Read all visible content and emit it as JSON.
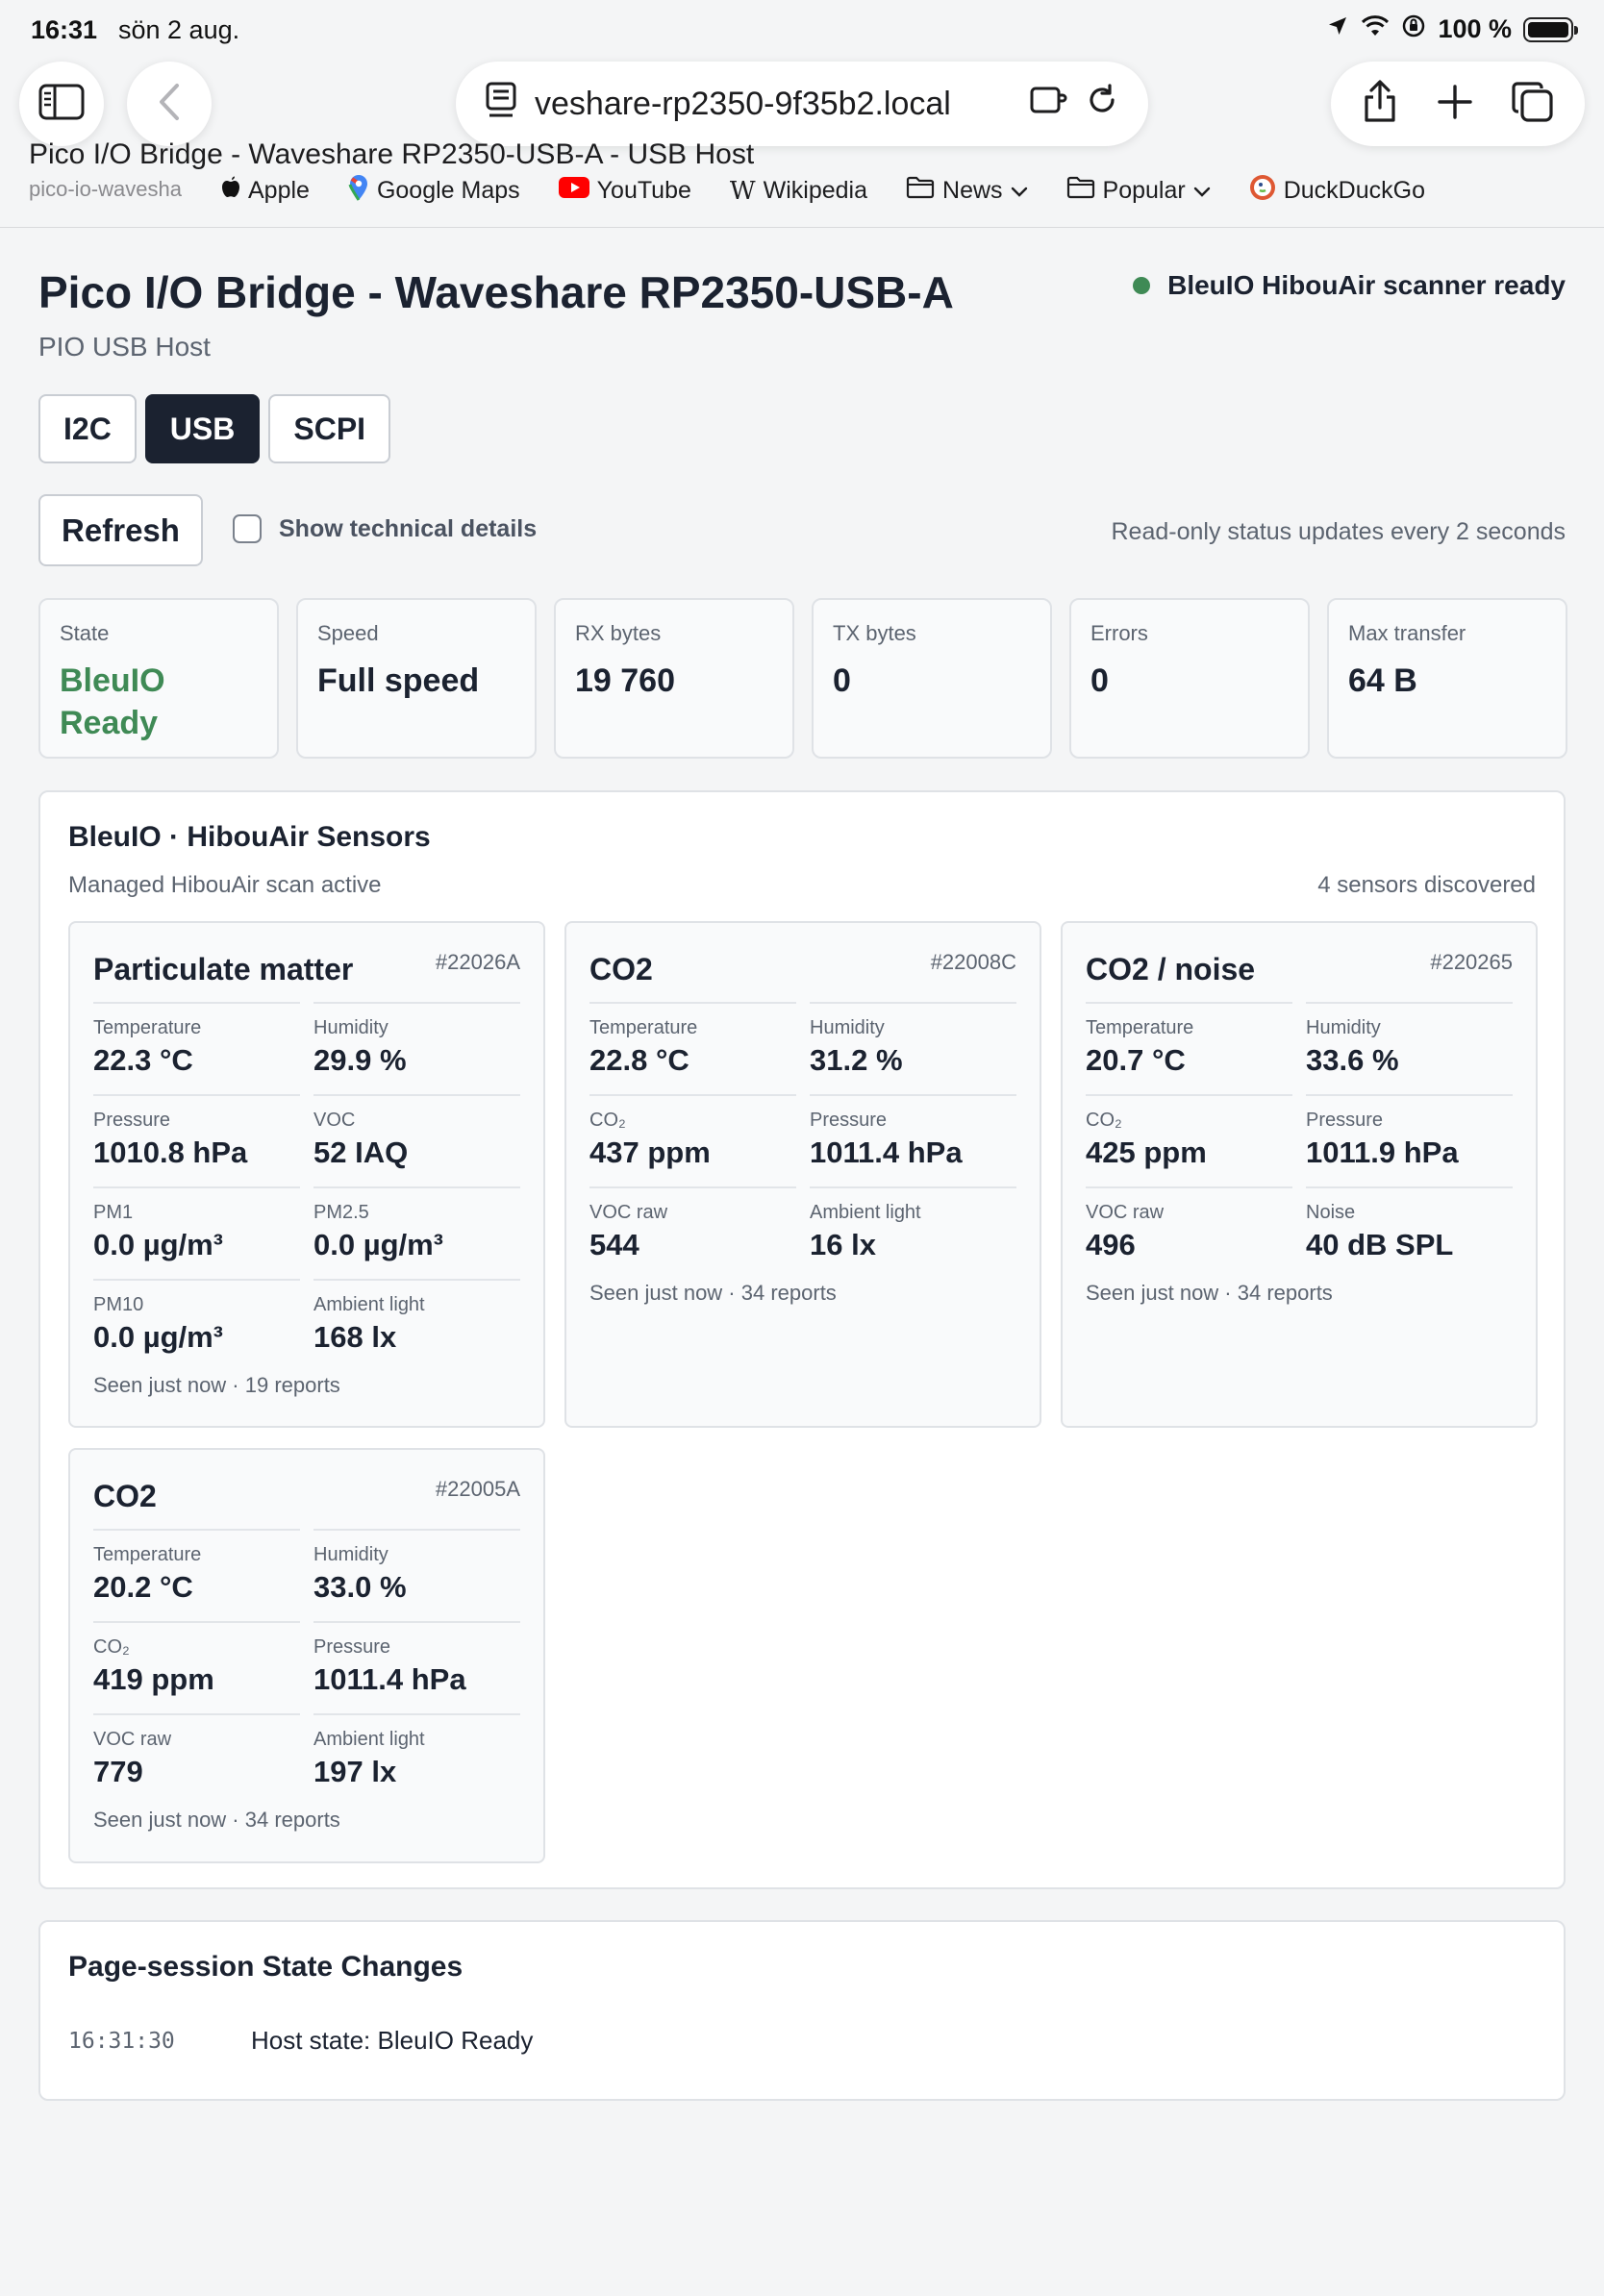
{
  "status_bar": {
    "time": "16:31",
    "date": "sön 2 aug.",
    "battery": "100 %"
  },
  "browser": {
    "url": "veshare-rp2350-9f35b2.local",
    "tab_title": "Pico I/O Bridge - Waveshare RP2350-USB-A - USB Host",
    "tab_host": "pico-io-wavesha",
    "favorites": [
      {
        "label": "Apple",
        "icon": "apple-icon"
      },
      {
        "label": "Google Maps",
        "icon": "maps-icon"
      },
      {
        "label": "YouTube",
        "icon": "youtube-icon"
      },
      {
        "label": "Wikipedia",
        "icon": "wikipedia-icon"
      },
      {
        "label": "News",
        "icon": "folder-icon"
      },
      {
        "label": "Popular",
        "icon": "folder-icon"
      },
      {
        "label": "DuckDuckGo",
        "icon": "duckduckgo-icon"
      }
    ]
  },
  "header": {
    "title": "Pico I/O Bridge - Waveshare RP2350-USB-A",
    "subtitle": "PIO USB Host",
    "status": "BleuIO HibouAir scanner ready",
    "status_color": "#3f8a55"
  },
  "tabs": [
    "I2C",
    "USB",
    "SCPI"
  ],
  "active_tab": "USB",
  "toolbar": {
    "refresh": "Refresh",
    "tech_details": "Show technical details",
    "update_note": "Read-only status updates every 2 seconds"
  },
  "stats": [
    {
      "label": "State",
      "value": "BleuIO Ready"
    },
    {
      "label": "Speed",
      "value": "Full speed"
    },
    {
      "label": "RX bytes",
      "value": "19 760"
    },
    {
      "label": "TX bytes",
      "value": "0"
    },
    {
      "label": "Errors",
      "value": "0"
    },
    {
      "label": "Max transfer",
      "value": "64 B"
    }
  ],
  "sensors_panel": {
    "title": "BleuIO · HibouAir Sensors",
    "subtitle": "Managed HibouAir scan active",
    "count": "4 sensors discovered",
    "sensors": [
      {
        "name": "Particulate matter",
        "id": "#22026A",
        "metrics": [
          {
            "label": "Temperature",
            "value": "22.3 °C"
          },
          {
            "label": "Humidity",
            "value": "29.9 %"
          },
          {
            "label": "Pressure",
            "value": "1010.8 hPa"
          },
          {
            "label": "VOC",
            "value": "52 IAQ"
          },
          {
            "label": "PM1",
            "value": "0.0 µg/m³"
          },
          {
            "label": "PM2.5",
            "value": "0.0 µg/m³"
          },
          {
            "label": "PM10",
            "value": "0.0 µg/m³"
          },
          {
            "label": "Ambient light",
            "value": "168 lx"
          }
        ],
        "footer": "Seen just now · 19 reports"
      },
      {
        "name": "CO2",
        "id": "#22008C",
        "metrics": [
          {
            "label": "Temperature",
            "value": "22.8 °C"
          },
          {
            "label": "Humidity",
            "value": "31.2 %"
          },
          {
            "label": "CO₂",
            "value": "437 ppm"
          },
          {
            "label": "Pressure",
            "value": "1011.4 hPa"
          },
          {
            "label": "VOC raw",
            "value": "544"
          },
          {
            "label": "Ambient light",
            "value": "16 lx"
          }
        ],
        "footer": "Seen just now · 34 reports"
      },
      {
        "name": "CO2 / noise",
        "id": "#220265",
        "metrics": [
          {
            "label": "Temperature",
            "value": "20.7 °C"
          },
          {
            "label": "Humidity",
            "value": "33.6 %"
          },
          {
            "label": "CO₂",
            "value": "425 ppm"
          },
          {
            "label": "Pressure",
            "value": "1011.9 hPa"
          },
          {
            "label": "VOC raw",
            "value": "496"
          },
          {
            "label": "Noise",
            "value": "40 dB SPL"
          }
        ],
        "footer": "Seen just now · 34 reports"
      },
      {
        "name": "CO2",
        "id": "#22005A",
        "metrics": [
          {
            "label": "Temperature",
            "value": "20.2 °C"
          },
          {
            "label": "Humidity",
            "value": "33.0 %"
          },
          {
            "label": "CO₂",
            "value": "419 ppm"
          },
          {
            "label": "Pressure",
            "value": "1011.4 hPa"
          },
          {
            "label": "VOC raw",
            "value": "779"
          },
          {
            "label": "Ambient light",
            "value": "197 lx"
          }
        ],
        "footer": "Seen just now · 34 reports"
      }
    ]
  },
  "log_panel": {
    "title": "Page-session State Changes",
    "entries": [
      {
        "time": "16:31:30",
        "text": "Host state: BleuIO Ready"
      }
    ]
  }
}
